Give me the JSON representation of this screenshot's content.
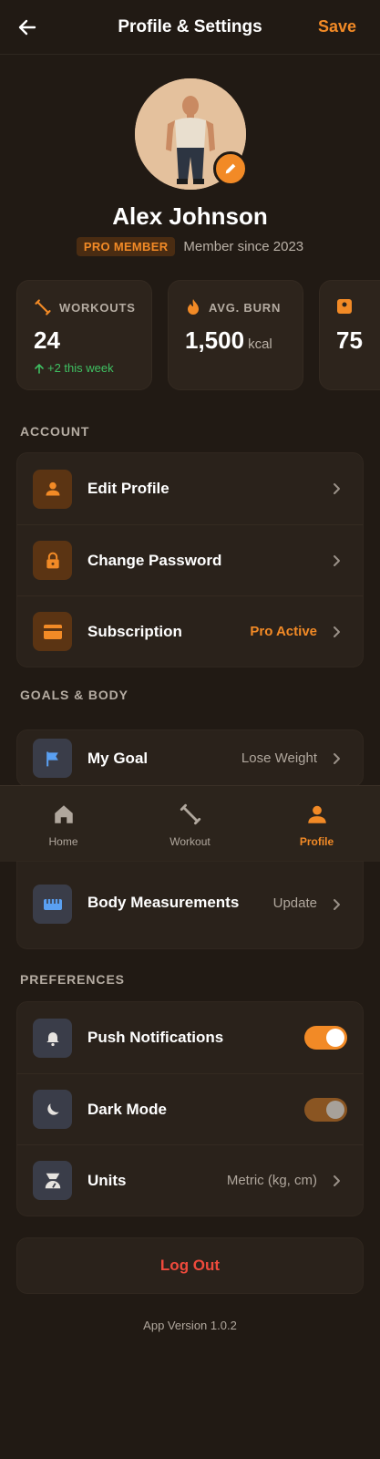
{
  "header": {
    "title": "Profile & Settings",
    "save_label": "Save",
    "back_icon": "arrow-left-icon"
  },
  "profile": {
    "name": "Alex Johnson",
    "badge": "PRO MEMBER",
    "member_since": "Member since 2023",
    "edit_icon": "pencil-icon"
  },
  "stats": [
    {
      "label": "WORKOUTS",
      "value": "24",
      "unit": "",
      "delta": "+2 this week",
      "icon": "dumbbell-icon"
    },
    {
      "label": "AVG. BURN",
      "value": "1,500",
      "unit": "kcal",
      "delta": "",
      "icon": "flame-icon"
    },
    {
      "label": "",
      "value": "75",
      "unit": "",
      "delta": "",
      "icon": "scale-icon"
    }
  ],
  "sections": {
    "account": "ACCOUNT",
    "goals": "GOALS & BODY",
    "preferences": "PREFERENCES"
  },
  "account_items": [
    {
      "label": "Edit Profile",
      "value": "",
      "icon": "user-icon"
    },
    {
      "label": "Change Password",
      "value": "",
      "icon": "lock-icon"
    },
    {
      "label": "Subscription",
      "value": "Pro Active",
      "icon": "credit-card-icon"
    }
  ],
  "goals_items": [
    {
      "label": "My Goal",
      "value": "Lose Weight",
      "icon": "flag-icon"
    },
    {
      "label": "Body Measurements",
      "value": "Update",
      "icon": "ruler-icon"
    }
  ],
  "preferences_items": [
    {
      "label": "Push Notifications",
      "toggle": true,
      "icon": "bell-icon"
    },
    {
      "label": "Dark Mode",
      "toggle": true,
      "icon": "moon-icon"
    },
    {
      "label": "Units",
      "value": "Metric (kg, cm)",
      "icon": "scale-icon"
    }
  ],
  "tabbar": [
    {
      "label": "Home",
      "icon": "home-icon",
      "active": false
    },
    {
      "label": "Workout",
      "icon": "dumbbell-icon",
      "active": false
    },
    {
      "label": "Profile",
      "icon": "user-icon",
      "active": true
    }
  ],
  "logout_label": "Log Out",
  "app_version": "App Version 1.0.2",
  "colors": {
    "accent": "#f28a26",
    "background": "#211a14",
    "card": "#2a221b",
    "danger": "#ef4a3c",
    "success": "#3fc062"
  }
}
